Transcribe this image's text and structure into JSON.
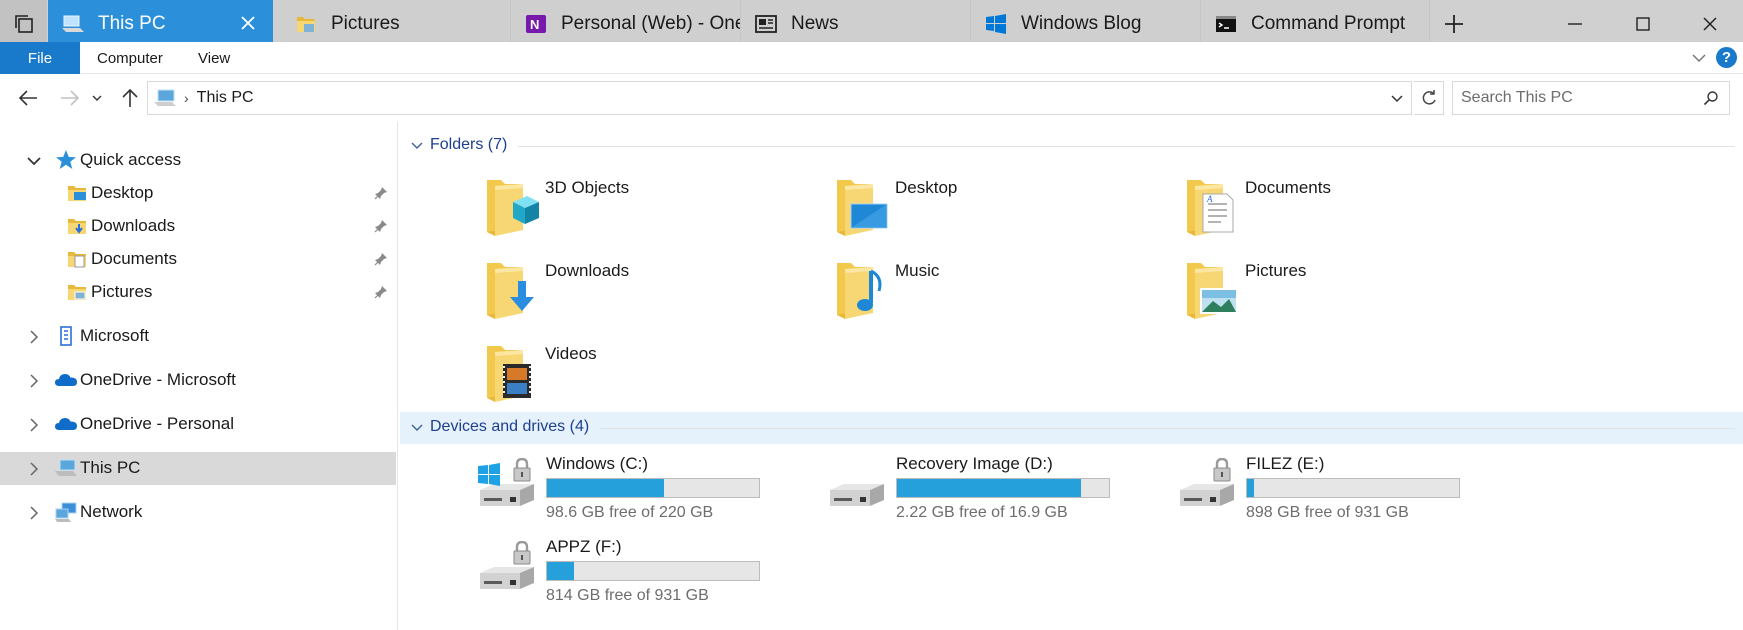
{
  "tabs": [
    {
      "label": "This PC",
      "icon": "this-pc-icon",
      "active": true
    },
    {
      "label": "Pictures",
      "icon": "pictures-folder-icon"
    },
    {
      "label": "Personal (Web) - One",
      "icon": "onenote-icon"
    },
    {
      "label": "News",
      "icon": "news-icon"
    },
    {
      "label": "Windows Blog",
      "icon": "windows-logo-icon"
    },
    {
      "label": "Command Prompt",
      "icon": "command-prompt-icon"
    }
  ],
  "ribbon": {
    "file": "File",
    "computer": "Computer",
    "view": "View",
    "help": "?"
  },
  "address": {
    "breadcrumb": "This PC"
  },
  "search": {
    "placeholder": "Search This PC"
  },
  "nav": {
    "quick_access": "Quick access",
    "quick_items": [
      {
        "label": "Desktop",
        "icon": "desktop-folder-icon"
      },
      {
        "label": "Downloads",
        "icon": "downloads-folder-icon"
      },
      {
        "label": "Documents",
        "icon": "documents-folder-icon"
      },
      {
        "label": "Pictures",
        "icon": "pictures-folder-icon"
      }
    ],
    "microsoft": "Microsoft",
    "onedrive_ms": "OneDrive - Microsoft",
    "onedrive_personal": "OneDrive - Personal",
    "this_pc": "This PC",
    "network": "Network"
  },
  "folders": {
    "header": "Folders (7)",
    "items": [
      {
        "label": "3D Objects",
        "icon": "3d-objects-folder-icon"
      },
      {
        "label": "Desktop",
        "icon": "desktop-folder-icon"
      },
      {
        "label": "Documents",
        "icon": "documents-folder-icon"
      },
      {
        "label": "Downloads",
        "icon": "downloads-folder-icon"
      },
      {
        "label": "Music",
        "icon": "music-folder-icon"
      },
      {
        "label": "Pictures",
        "icon": "pictures-folder-icon"
      },
      {
        "label": "Videos",
        "icon": "videos-folder-icon"
      }
    ]
  },
  "drives": {
    "header": "Devices and drives (4)",
    "items": [
      {
        "label": "Windows (C:)",
        "free": "98.6 GB free of 220 GB",
        "used_fraction": 0.552,
        "icon": "windows-drive-locked-icon"
      },
      {
        "label": "Recovery Image (D:)",
        "free": "2.22 GB free of 16.9 GB",
        "used_fraction": 0.869,
        "icon": "drive-icon"
      },
      {
        "label": "FILEZ (E:)",
        "free": "898 GB free of 931 GB",
        "used_fraction": 0.035,
        "icon": "drive-locked-icon"
      },
      {
        "label": "APPZ (F:)",
        "free": "814 GB free of 931 GB",
        "used_fraction": 0.126,
        "icon": "drive-locked-icon"
      }
    ]
  },
  "colors": {
    "accent": "#2b90d9",
    "ribbon_file": "#1979ca",
    "usage_bar": "#26a0da",
    "group_header": "#1e3f8f"
  }
}
